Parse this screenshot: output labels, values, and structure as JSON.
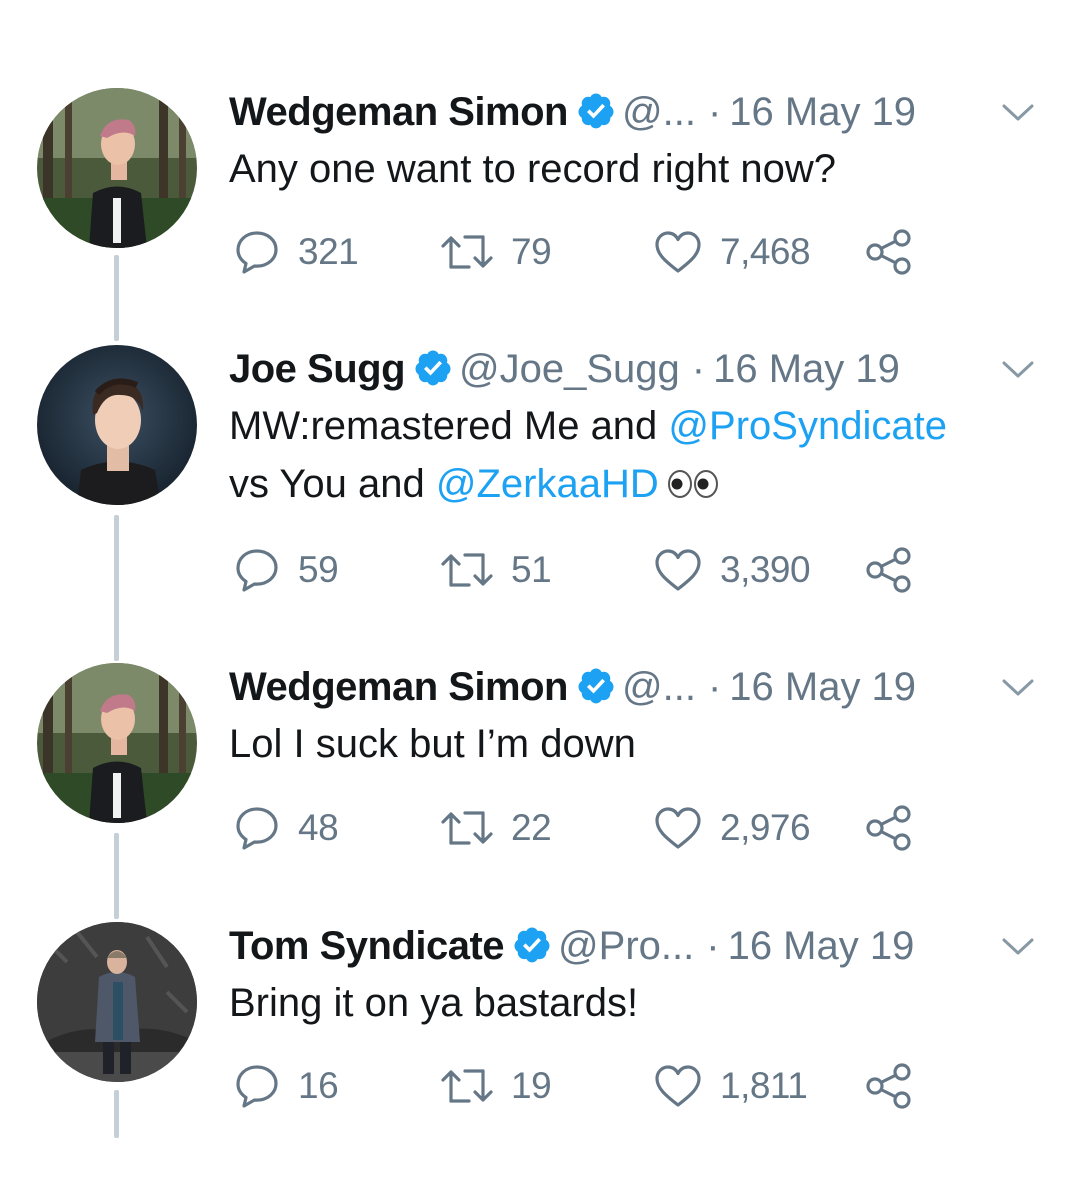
{
  "colors": {
    "text": "#14171a",
    "secondary": "#657786",
    "link": "#1da1f2",
    "verified": "#1da1f2",
    "thread_line": "#c4cfd6"
  },
  "tweets": [
    {
      "name": "Wedgeman Simon",
      "handle": "@...",
      "date": "16 May 19",
      "text_parts": [
        {
          "text": "Any one want to record right now?",
          "type": "text"
        }
      ],
      "replies": "321",
      "retweets": "79",
      "likes": "7,468",
      "avatar": "simon-avatar"
    },
    {
      "name": "Joe Sugg",
      "handle": "@Joe_Sugg",
      "date": "16 May 19",
      "text_parts": [
        {
          "text": "MW:remastered Me and ",
          "type": "text"
        },
        {
          "text": "@ProSyndicate",
          "type": "mention"
        },
        {
          "text": "vs You and ",
          "type": "text"
        },
        {
          "text": "@ZerkaaHD",
          "type": "mention"
        },
        {
          "text": "eyes-emoji",
          "type": "emoji"
        }
      ],
      "replies": "59",
      "retweets": "51",
      "likes": "3,390",
      "avatar": "joe-avatar"
    },
    {
      "name": "Wedgeman Simon",
      "handle": "@...",
      "date": "16 May 19",
      "text_parts": [
        {
          "text": "Lol I suck but I’m down",
          "type": "text"
        }
      ],
      "replies": "48",
      "retweets": "22",
      "likes": "2,976",
      "avatar": "simon-avatar"
    },
    {
      "name": "Tom Syndicate",
      "handle": "@Pro...",
      "date": "16 May 19",
      "text_parts": [
        {
          "text": "Bring it on ya bastards!",
          "type": "text"
        }
      ],
      "replies": "16",
      "retweets": "19",
      "likes": "1,811",
      "avatar": "tom-avatar"
    }
  ]
}
